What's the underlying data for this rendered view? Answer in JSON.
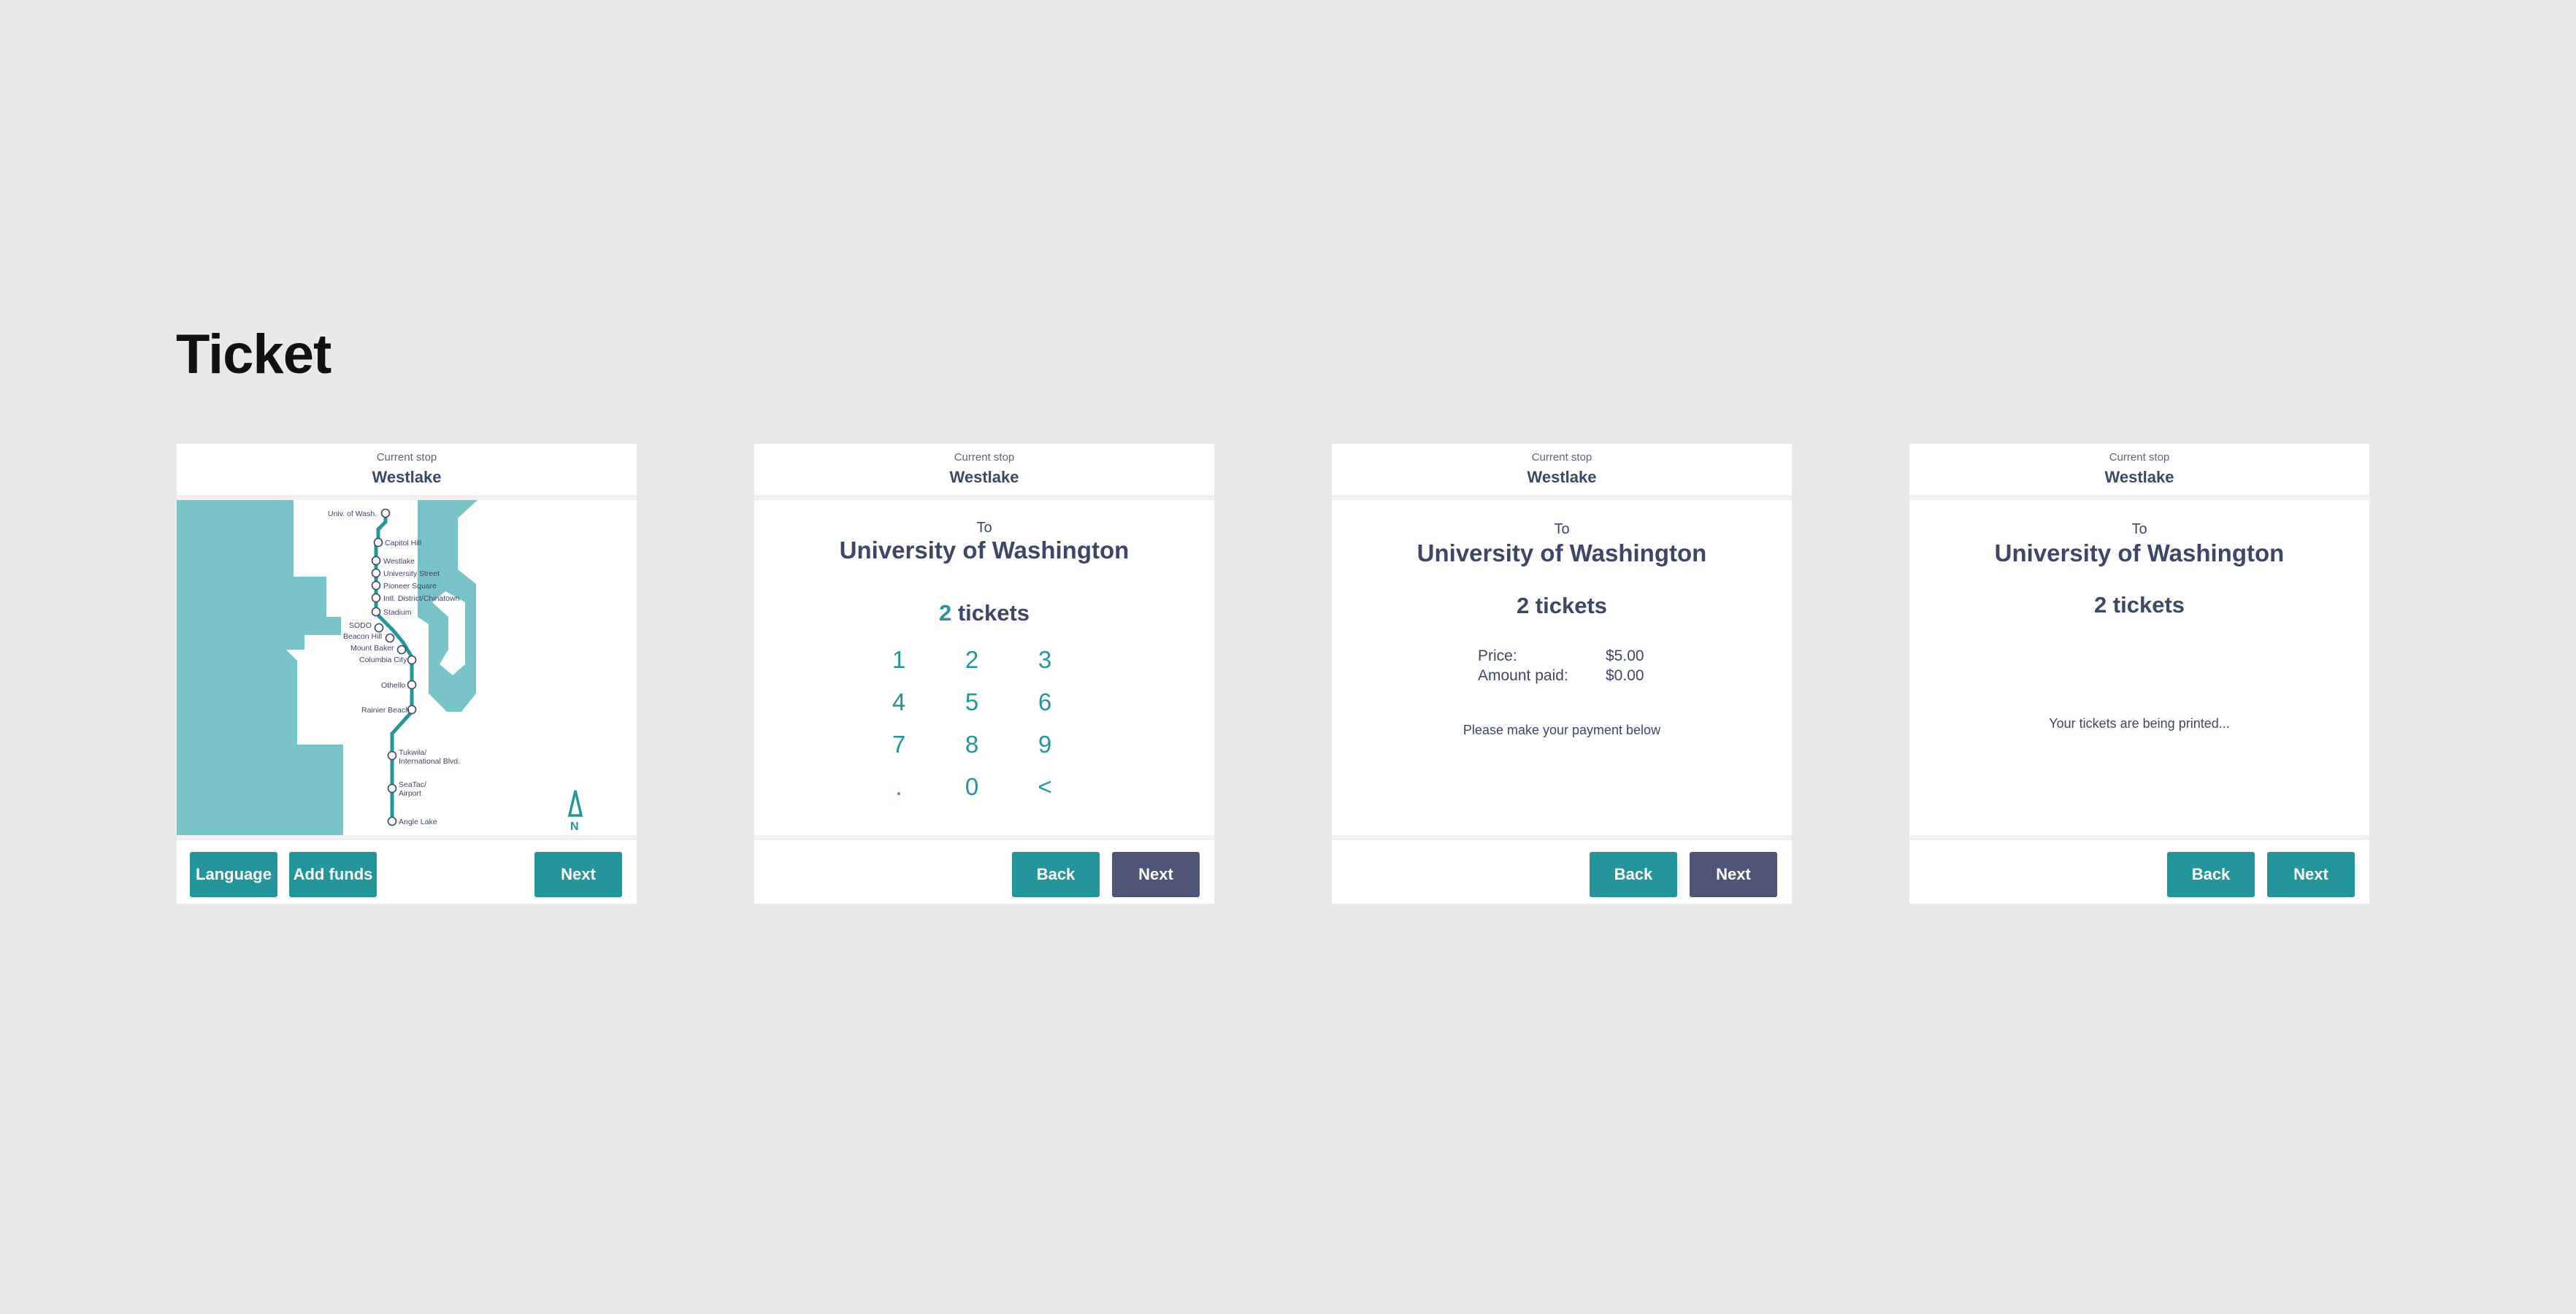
{
  "page": {
    "title": "Ticket"
  },
  "colors": {
    "teal": "#24959a",
    "slate": "#4f5577",
    "map_water": "#79c4c7",
    "text": "#3e4766"
  },
  "screens": [
    {
      "current_stop_label": "Current stop",
      "current_stop": "Westlake",
      "map": {
        "stations": [
          "Univ. of Wash.",
          "Capitol Hill",
          "Westlake",
          "University Street",
          "Pioneer Square",
          "Intl. District/Chinatown",
          "Stadium",
          "SODO",
          "Beacon Hill",
          "Mount Baker",
          "Columbia City",
          "Othello",
          "Rainier Beach",
          "Tukwila/",
          "International Blvd.",
          "SeaTac/",
          "Airport",
          "Angle Lake"
        ],
        "north_label": "N"
      },
      "buttons": {
        "language": "Language",
        "add_funds": "Add funds",
        "next": "Next"
      }
    },
    {
      "current_stop_label": "Current stop",
      "current_stop": "Westlake",
      "to_label": "To",
      "destination": "University of Washington",
      "ticket_count": "2",
      "tickets_word": "tickets",
      "keys": [
        "1",
        "2",
        "3",
        "4",
        "5",
        "6",
        "7",
        "8",
        "9",
        ".",
        "0",
        "<"
      ],
      "buttons": {
        "back": "Back",
        "next": "Next"
      }
    },
    {
      "current_stop_label": "Current stop",
      "current_stop": "Westlake",
      "to_label": "To",
      "destination": "University of Washington",
      "tickets_text": "2 tickets",
      "price_label": "Price:",
      "price_value": "$5.00",
      "paid_label": "Amount paid:",
      "paid_value": "$0.00",
      "message": "Please make your payment below",
      "buttons": {
        "back": "Back",
        "next": "Next"
      }
    },
    {
      "current_stop_label": "Current stop",
      "current_stop": "Westlake",
      "to_label": "To",
      "destination": "University of Washington",
      "tickets_text": "2 tickets",
      "message": "Your tickets are being printed...",
      "buttons": {
        "back": "Back",
        "next": "Next"
      }
    }
  ]
}
